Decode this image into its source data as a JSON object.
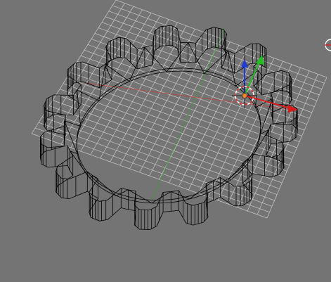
{
  "app": {
    "view": "3d-viewport",
    "shading": "wireframe"
  },
  "scene": {
    "object": "gear",
    "teeth": 15,
    "selected_element": "cursor-gizmo"
  },
  "gizmo": {
    "x_axis_color": "#d81b1b",
    "y_axis_color": "#1fbf1f",
    "z_axis_color": "#1f3bd8",
    "pivot_color": "#f08a2a"
  },
  "colors": {
    "background": "#747474",
    "grid": "#d8d8d8",
    "wire": "#000000"
  },
  "icons": [
    "move-gizmo-icon",
    "cursor-icon"
  ]
}
